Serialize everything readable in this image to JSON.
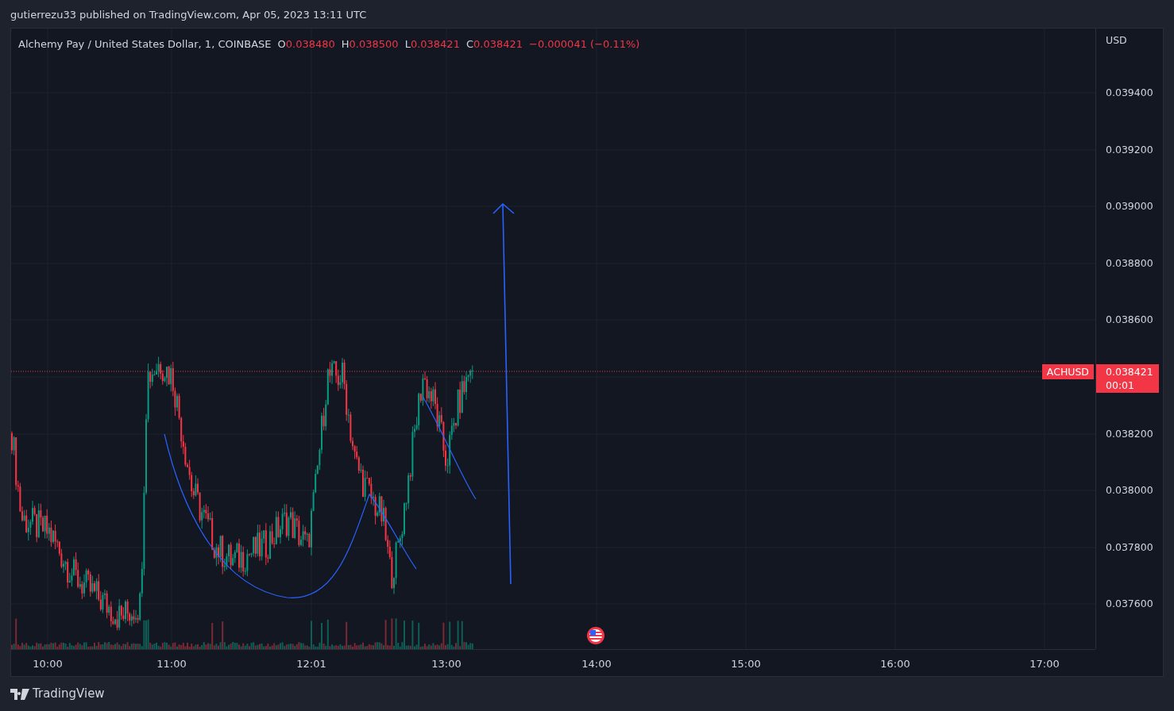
{
  "header": {
    "text": "gutierrezu33 published on TradingView.com, Apr 05, 2023 13:11 UTC"
  },
  "legend": {
    "symbol": "Alchemy Pay / United States Dollar, 1, COINBASE",
    "values": [
      {
        "label": "O",
        "value": "0.038480"
      },
      {
        "label": "H",
        "value": "0.038500"
      },
      {
        "label": "L",
        "value": "0.038421"
      },
      {
        "label": "C",
        "value": "0.038421"
      }
    ],
    "change": "−0.000041 (−0.11%)"
  },
  "price_axis": {
    "currency": "USD",
    "ticks": [
      "0.039400",
      "0.039200",
      "0.039000",
      "0.038800",
      "0.038600",
      "0.038200",
      "0.038000",
      "0.037800",
      "0.037600"
    ]
  },
  "last_price": {
    "symbol": "ACHUSD",
    "price": "0.038421",
    "countdown": "00:01"
  },
  "time_axis": {
    "ticks": [
      "10:00",
      "11:00",
      "12:01",
      "13:00",
      "14:00",
      "15:00",
      "16:00",
      "17:00"
    ]
  },
  "footer": {
    "brand": "TradingView"
  }
}
